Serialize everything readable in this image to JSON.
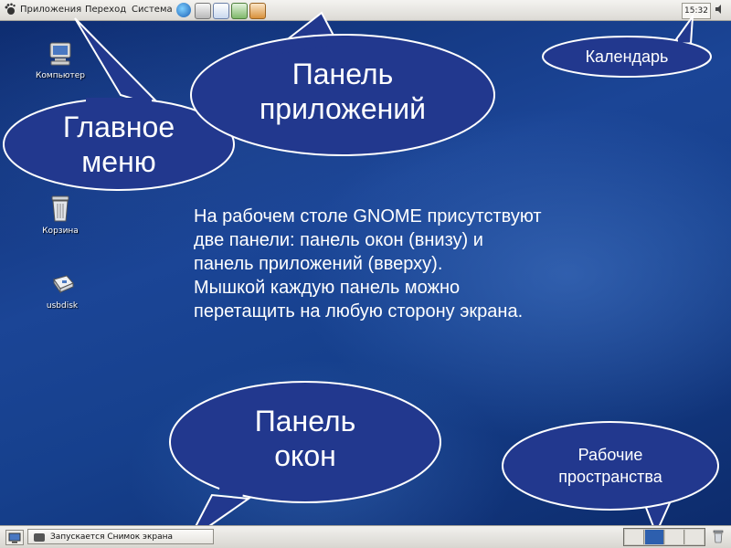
{
  "top_panel": {
    "menus": [
      "Приложения",
      "Переход",
      "Система"
    ],
    "launchers": [
      "browser-icon",
      "mail-icon",
      "writer-icon",
      "calc-icon",
      "presentation-icon"
    ],
    "clock": "15:32"
  },
  "desktop_icons": [
    {
      "label": "Компьютер",
      "icon": "computer-icon"
    },
    {
      "label": "Корзина",
      "icon": "trash-icon"
    },
    {
      "label": "usbdisk",
      "icon": "usb-disk-icon"
    }
  ],
  "description_lines": [
    "На рабочем столе GNOME присутствуют",
    "две панели: панель окон (внизу) и",
    "панель приложений (вверху).",
    "Мышкой каждую панель можно",
    "перетащить на любую сторону экрана."
  ],
  "callouts": {
    "main_menu": [
      "Главное",
      "меню"
    ],
    "app_panel": [
      "Панель",
      "приложений"
    ],
    "calendar": [
      "Календарь"
    ],
    "window_panel": [
      "Панель",
      "окон"
    ],
    "workspaces": [
      "Рабочие",
      "пространства"
    ]
  },
  "bottom_panel": {
    "task_label": "Запускается Снимок экрана",
    "workspace_count": 4,
    "active_workspace": 2
  },
  "colors": {
    "bubble_fill": "#22388e",
    "bubble_stroke": "#ffffff",
    "desktop": "#16408d"
  }
}
